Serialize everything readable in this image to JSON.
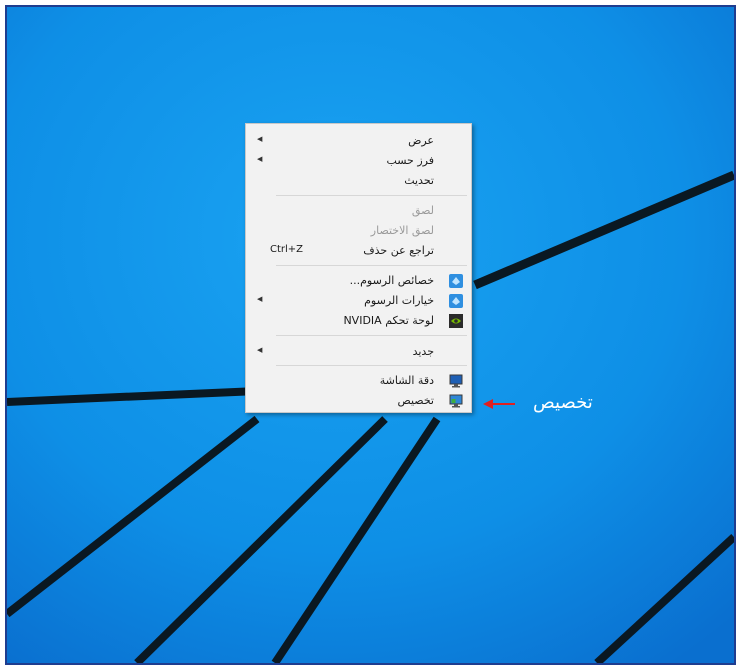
{
  "menu": {
    "items": [
      {
        "label": "عرض",
        "submenu": true
      },
      {
        "label": "فرز حسب",
        "submenu": true
      },
      {
        "label": "تحديث"
      },
      {
        "label": "لصق",
        "disabled": true
      },
      {
        "label": "لصق الاختصار",
        "disabled": true
      },
      {
        "label": "تراجع عن حذف",
        "shortcut": "Ctrl+Z"
      },
      {
        "label": "خصائص الرسوم...",
        "icon": "intel-graphics-icon"
      },
      {
        "label": "خيارات الرسوم",
        "icon": "intel-graphics-icon",
        "submenu": true
      },
      {
        "label": "لوحة تحكم NVIDIA",
        "icon": "nvidia-icon"
      },
      {
        "label": "جديد",
        "submenu": true
      },
      {
        "label": "دقة الشاشة",
        "icon": "display-icon"
      },
      {
        "label": "تخصيص",
        "icon": "personalize-icon"
      }
    ]
  },
  "annotation": {
    "label": "تخصيص",
    "arrow_color": "#e02020"
  },
  "colors": {
    "desktop_blue": "#0e8fe6",
    "frame_border": "#1f3d8f"
  }
}
